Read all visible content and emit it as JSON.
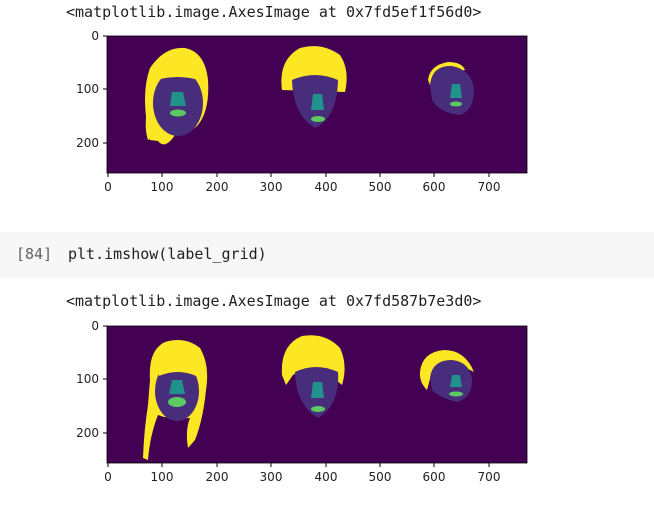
{
  "outputs": [
    {
      "text": "<matplotlib.image.AxesImage at 0x7fd5ef1f56d0>"
    },
    {
      "text": "<matplotlib.image.AxesImage at 0x7fd587b7e3d0>"
    }
  ],
  "cell": {
    "prompt": "[84]",
    "code": "plt.imshow(label_grid)"
  },
  "plot_axes": {
    "xticks": [
      "0",
      "100",
      "200",
      "300",
      "400",
      "500",
      "600",
      "700"
    ],
    "yticks": [
      "0",
      "100",
      "200"
    ]
  },
  "colors": {
    "background": "#440154",
    "hair": "#fde725",
    "face": "#472d7b",
    "nose": "#21918c",
    "mouth": "#5ec962"
  }
}
